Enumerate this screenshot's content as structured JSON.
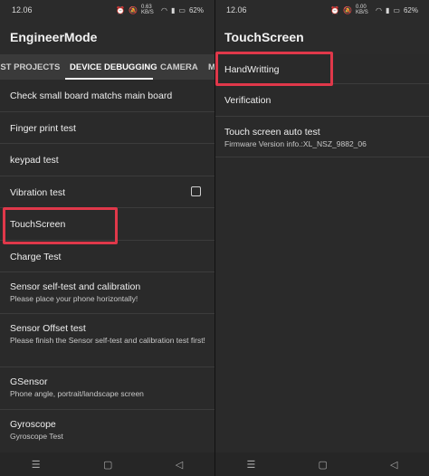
{
  "left": {
    "status": {
      "time": "12.06",
      "battery": "62%",
      "speed": "0.63 KB/S"
    },
    "app_title": "EngineerMode",
    "tabs": [
      "EST PROJECTS",
      "DEVICE DEBUGGING",
      "CAMERA",
      "M"
    ],
    "active_tab": "DEVICE DEBUGGING",
    "items": [
      {
        "title": "Check small board matchs main board",
        "sub": ""
      },
      {
        "title": "Finger print test",
        "sub": ""
      },
      {
        "title": "keypad test",
        "sub": ""
      },
      {
        "title": "Vibration test",
        "sub": "",
        "checkbox": true
      },
      {
        "title": "TouchScreen",
        "sub": ""
      },
      {
        "title": "Charge Test",
        "sub": ""
      },
      {
        "title": "Sensor self-test and calibration",
        "sub": "Please place your phone horizontally!"
      },
      {
        "title": "Sensor Offset test",
        "sub": "Please finish the Sensor self-test and calibration test first!"
      },
      {
        "title": "GSensor",
        "sub": "Phone angle, portrait/landscape screen"
      },
      {
        "title": "Gyroscope",
        "sub": "Gyroscope Test"
      }
    ]
  },
  "right": {
    "status": {
      "time": "12.06",
      "battery": "62%",
      "speed": "0.00 KB/S"
    },
    "app_title": "TouchScreen",
    "items": [
      {
        "title": "HandWritting",
        "sub": ""
      },
      {
        "title": "Verification",
        "sub": ""
      },
      {
        "title": "Touch screen auto test",
        "sub": "Firmware Version info.:XL_NSZ_9882_06"
      }
    ]
  },
  "nav": {
    "menu": "☰",
    "home": "▢",
    "back": "◁"
  }
}
